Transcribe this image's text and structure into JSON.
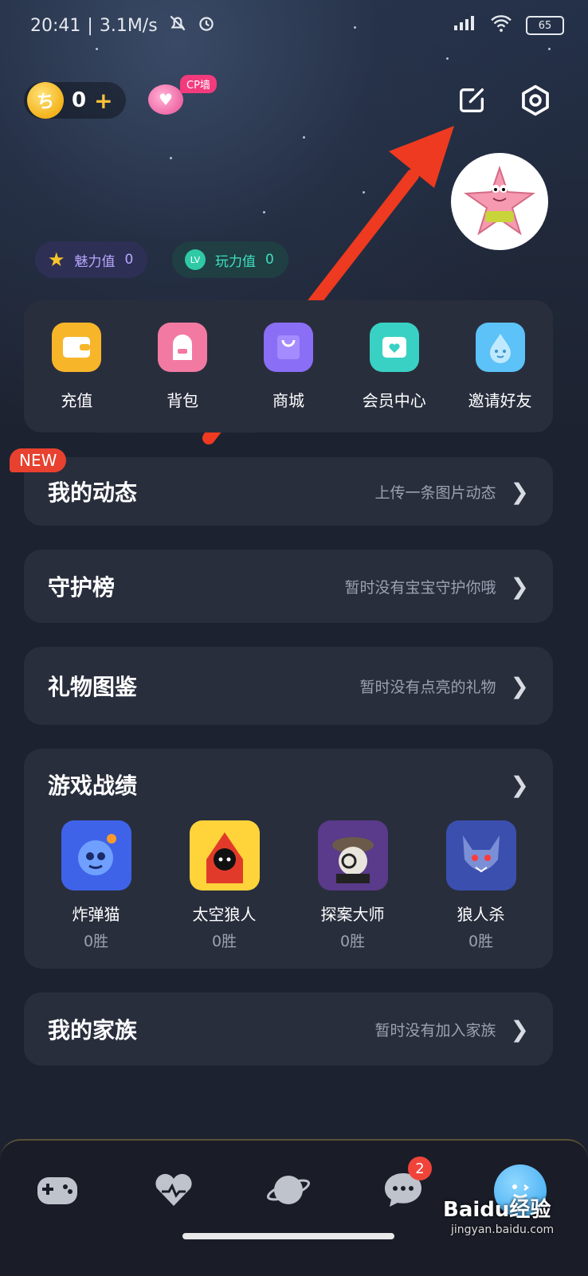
{
  "status_bar": {
    "time": "20:41",
    "speed": "3.1M/s",
    "battery": "65"
  },
  "wallet": {
    "coins": "0",
    "plus": "+"
  },
  "cp_wall": {
    "tag": "CP墙"
  },
  "header_icons": [
    "edit-icon",
    "settings-icon"
  ],
  "badges": [
    {
      "label": "魅力值",
      "value": "0"
    },
    {
      "label": "玩力值",
      "value": "0",
      "icon_text": "LV"
    }
  ],
  "quick_menu": [
    {
      "label": "充值",
      "color": "#f7b52a"
    },
    {
      "label": "背包",
      "color": "#f27aa2"
    },
    {
      "label": "商城",
      "color": "#8a6ef5"
    },
    {
      "label": "会员中心",
      "color": "#39d1c3"
    },
    {
      "label": "邀请好友",
      "color": "#5cc2f7"
    }
  ],
  "new_tag": "NEW",
  "rows": {
    "moments": {
      "title": "我的动态",
      "subtitle": "上传一条图片动态"
    },
    "guard": {
      "title": "守护榜",
      "subtitle": "暂时没有宝宝守护你哦"
    },
    "gifts": {
      "title": "礼物图鉴",
      "subtitle": "暂时没有点亮的礼物"
    },
    "family": {
      "title": "我的家族",
      "subtitle": "暂时没有加入家族"
    }
  },
  "games": {
    "title": "游戏战绩",
    "items": [
      {
        "name": "炸弹猫",
        "wins": "0胜"
      },
      {
        "name": "太空狼人",
        "wins": "0胜"
      },
      {
        "name": "探案大师",
        "wins": "0胜"
      },
      {
        "name": "狼人杀",
        "wins": "0胜"
      }
    ]
  },
  "tabbar": {
    "message_badge": "2"
  },
  "watermark": {
    "brand": "Baidu经验",
    "url": "jingyan.baidu.com"
  }
}
